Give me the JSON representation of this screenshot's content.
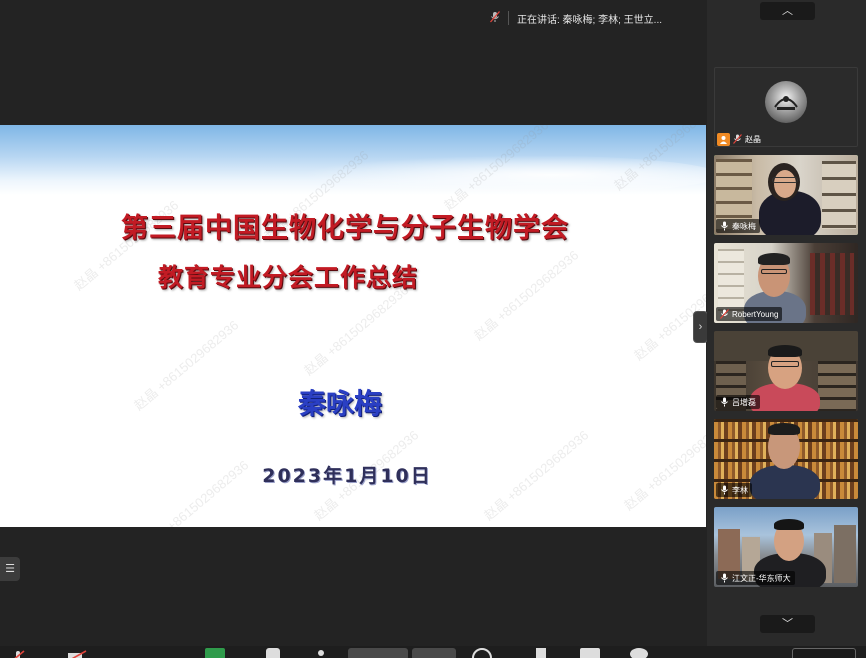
{
  "speaking": {
    "text": "正在讲话: 秦咏梅; 李林; 王世立..."
  },
  "slide": {
    "title_line_1": "第三届中国生物化学与分子生物学会",
    "title_line_2": "教育专业分会工作总结",
    "presenter": "秦咏梅",
    "date": "2023年1月10日",
    "watermark": "赵晶 +8615029682936"
  },
  "participants": [
    {
      "name": "赵晶",
      "tile": "avatar",
      "muted": true
    },
    {
      "name": "秦咏梅",
      "tile": "video",
      "muted": false,
      "speaking": true
    },
    {
      "name": "RobertYoung",
      "tile": "video",
      "muted": true
    },
    {
      "name": "吕增磊",
      "tile": "video",
      "muted": false
    },
    {
      "name": "李林",
      "tile": "video",
      "muted": false
    },
    {
      "name": "江文正-华东师大",
      "tile": "video",
      "muted": false
    }
  ],
  "icons": {
    "scroll_up": "chevron-up-icon",
    "scroll_down": "chevron-down-icon",
    "collapse": "chevron-right-icon",
    "list": "list-icon"
  },
  "colors": {
    "background": "#232323",
    "title_red": "#c21b24",
    "name_blue": "#2a3fc4",
    "active_speaker": "#35b25b"
  }
}
